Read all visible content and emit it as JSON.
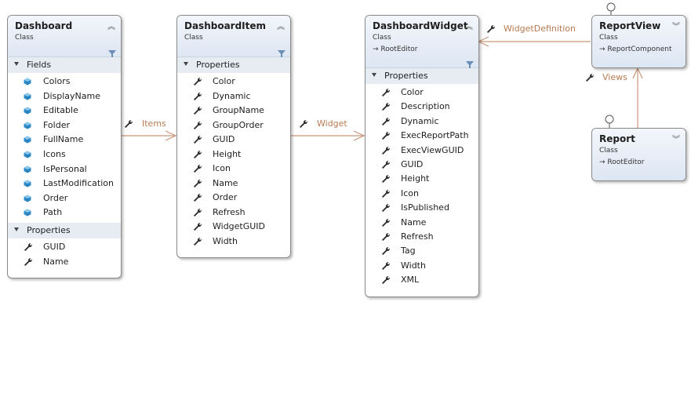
{
  "colors": {
    "connector": "#c8977a",
    "connector_label": "#b77a52",
    "field_icon": "#2e8bc9",
    "section_bg": "#e7ecf3"
  },
  "classes": {
    "dashboard": {
      "name": "Dashboard",
      "kind": "Class",
      "fields_label": "Fields",
      "fields": [
        "Colors",
        "DisplayName",
        "Editable",
        "Folder",
        "FullName",
        "Icons",
        "IsPersonal",
        "LastModification",
        "Order",
        "Path"
      ],
      "properties_label": "Properties",
      "properties": [
        "GUID",
        "Name"
      ]
    },
    "dashboard_item": {
      "name": "DashboardItem",
      "kind": "Class",
      "properties_label": "Properties",
      "properties": [
        "Color",
        "Dynamic",
        "GroupName",
        "GroupOrder",
        "GUID",
        "Height",
        "Icon",
        "Name",
        "Order",
        "Refresh",
        "WidgetGUID",
        "Width"
      ]
    },
    "dashboard_widget": {
      "name": "DashboardWidget",
      "kind": "Class",
      "base": "RootEditor",
      "properties_label": "Properties",
      "properties": [
        "Color",
        "Description",
        "Dynamic",
        "ExecReportPath",
        "ExecViewGUID",
        "GUID",
        "Height",
        "Icon",
        "IsPublished",
        "Name",
        "Refresh",
        "Tag",
        "Width",
        "XML"
      ]
    },
    "report_view": {
      "name": "ReportView",
      "kind": "Class",
      "base": "ReportComponent"
    },
    "report": {
      "name": "Report",
      "kind": "Class",
      "base": "RootEditor"
    }
  },
  "connectors": {
    "items": "Items",
    "widget": "Widget",
    "widget_definition": "WidgetDefinition",
    "views": "Views"
  }
}
